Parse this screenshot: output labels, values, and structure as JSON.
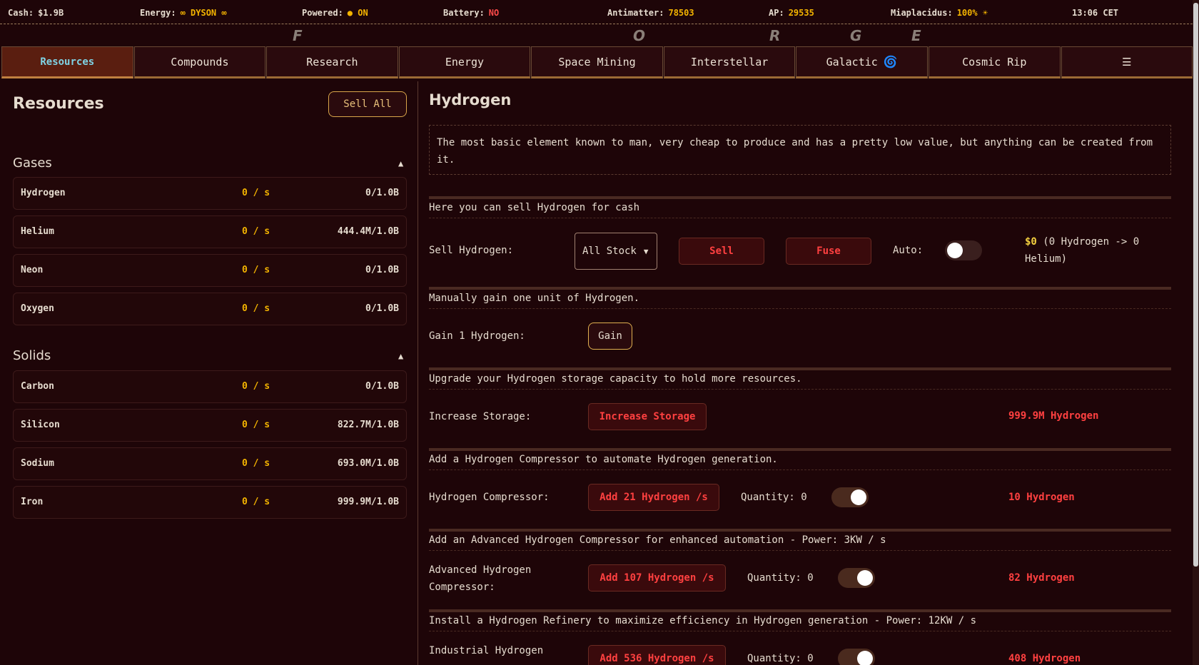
{
  "status": {
    "cash": {
      "label": "Cash:",
      "value": "$1.9B"
    },
    "energy": {
      "label": "Energy:",
      "value": "∞ DYSON ∞"
    },
    "powered": {
      "label": "Powered:",
      "value": "● ON"
    },
    "battery": {
      "label": "Battery:",
      "value": "NO"
    },
    "antimatter": {
      "label": "Antimatter:",
      "value": "78503"
    },
    "ap": {
      "label": "AP:",
      "value": "29535"
    },
    "miaplacidus": {
      "label": "Miaplacidus:",
      "value": "100% ☀"
    },
    "time": "13:06 CET"
  },
  "forge_letters": [
    "F",
    "O",
    "R",
    "G",
    "E"
  ],
  "tabs": [
    {
      "label": "Resources"
    },
    {
      "label": "Compounds"
    },
    {
      "label": "Research"
    },
    {
      "label": "Energy"
    },
    {
      "label": "Space Mining"
    },
    {
      "label": "Interstellar"
    },
    {
      "label": "Galactic"
    },
    {
      "label": "Cosmic Rip"
    },
    {
      "label": "☰"
    }
  ],
  "colors": {
    "accent": "#f4b400",
    "danger": "#ff4040",
    "active_tab_text": "#7fd4e6"
  },
  "left": {
    "title": "Resources",
    "sell_all": "Sell All",
    "groups": [
      {
        "title": "Gases",
        "arrow": "▲",
        "items": [
          {
            "name": "Hydrogen",
            "rate": "0 / s",
            "amount": "0/1.0B"
          },
          {
            "name": "Helium",
            "rate": "0 / s",
            "amount": "444.4M/1.0B"
          },
          {
            "name": "Neon",
            "rate": "0 / s",
            "amount": "0/1.0B"
          },
          {
            "name": "Oxygen",
            "rate": "0 / s",
            "amount": "0/1.0B"
          }
        ]
      },
      {
        "title": "Solids",
        "arrow": "▲",
        "items": [
          {
            "name": "Carbon",
            "rate": "0 / s",
            "amount": "0/1.0B"
          },
          {
            "name": "Silicon",
            "rate": "0 / s",
            "amount": "822.7M/1.0B"
          },
          {
            "name": "Sodium",
            "rate": "0 / s",
            "amount": "693.0M/1.0B"
          },
          {
            "name": "Iron",
            "rate": "0 / s",
            "amount": "999.9M/1.0B"
          }
        ]
      }
    ]
  },
  "detail": {
    "title": "Hydrogen",
    "description": "The most basic element known to man, very cheap to produce and has a pretty low value, but anything can be created from it.",
    "sell": {
      "heading": "Here you can sell Hydrogen for cash",
      "label": "Sell Hydrogen:",
      "select_value": "All Stock",
      "sell_button": "Sell",
      "fuse_button": "Fuse",
      "auto_label": "Auto:",
      "price_gold": "$0",
      "price_line1": " (0 Hydrogen -> 0",
      "price_line2": "Helium)"
    },
    "gain": {
      "heading": "Manually gain one unit of Hydrogen.",
      "label": "Gain 1 Hydrogen:",
      "button": "Gain"
    },
    "storage": {
      "heading": "Upgrade your Hydrogen storage capacity to hold more resources.",
      "label": "Increase Storage:",
      "button": "Increase Storage",
      "cost": "999.9M Hydrogen"
    },
    "compressor": {
      "heading": "Add a Hydrogen Compressor to automate Hydrogen generation.",
      "label": "Hydrogen Compressor:",
      "button": "Add 21 Hydrogen /s",
      "quantity": "Quantity: 0",
      "cost": "10 Hydrogen"
    },
    "advanced": {
      "heading": "Add an Advanced Hydrogen Compressor for enhanced automation - Power: 3KW / s",
      "label_line1": "Advanced Hydrogen",
      "label_line2": "Compressor:",
      "button": "Add 107 Hydrogen /s",
      "quantity": "Quantity: 0",
      "cost": "82 Hydrogen"
    },
    "refinery": {
      "heading": "Install a Hydrogen Refinery to maximize efficiency in Hydrogen generation - Power: 12KW / s",
      "label_line1": "Industrial Hydrogen",
      "button": "Add 536 Hydrogen /s",
      "quantity": "Quantity: 0",
      "cost": "408 Hydrogen"
    }
  }
}
